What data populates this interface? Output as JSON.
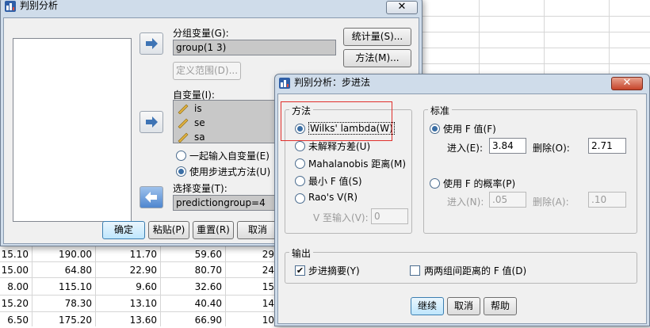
{
  "sheet": {
    "rows": [
      [
        "15.10",
        "190.00",
        "11.70",
        "59.60",
        "29"
      ],
      [
        "15.00",
        "64.80",
        "22.90",
        "80.70",
        "24"
      ],
      [
        "8.00",
        "115.10",
        "9.60",
        "32.60",
        "15"
      ],
      [
        "15.20",
        "78.30",
        "13.10",
        "40.40",
        "14"
      ],
      [
        "6.50",
        "175.20",
        "13.60",
        "66.90",
        "10"
      ]
    ]
  },
  "main_dialog": {
    "title": "判别分析",
    "grouping_label": "分组变量(G):",
    "grouping_value": "group(1 3)",
    "define_range_button": "定义范围(D)...",
    "independents_label": "自变量(I):",
    "independents": [
      "is",
      "se",
      "sa"
    ],
    "enter_together_label": "一起输入自变量(E)",
    "stepwise_label": "使用步进式方法(U)",
    "selection_label": "选择变量(T):",
    "selection_value": "predictiongroup=4",
    "statistics_button": "统计量(S)...",
    "method_button": "方法(M)...",
    "buttons": {
      "ok": "确定",
      "paste": "粘贴(P)",
      "reset": "重置(R)",
      "cancel": "取消"
    }
  },
  "stepwise_dialog": {
    "title": "判别分析：步进法",
    "method_group": "方法",
    "methods": [
      "Wilks' lambda(W)",
      "未解释方差(U)",
      "Mahalanobis 距离(M)",
      "最小 F 值(S)",
      "Rao's V(R)"
    ],
    "v_to_enter_label": "V 至输入(V):",
    "v_to_enter_value": "0",
    "criteria_group": "标准",
    "use_f_value": "使用 F 值(F)",
    "entry_label": "进入(E):",
    "entry_value": "3.84",
    "removal_label": "删除(O):",
    "removal_value": "2.71",
    "use_f_prob": "使用 F 的概率(P)",
    "entry_n_label": "进入(N):",
    "entry_n_value": ".05",
    "removal_a_label": "删除(A):",
    "removal_a_value": ".10",
    "output_group": "输出",
    "summary_label": "步进摘要(Y)",
    "pairwise_label": "两两组间距离的 F 值(D)",
    "buttons": {
      "continue": "继续",
      "cancel": "取消",
      "help": "帮助"
    }
  },
  "colors": {
    "highlight_box": "#e0302c",
    "title_bar": "#cfdcea",
    "dialog_body": "#f0f0f0"
  }
}
